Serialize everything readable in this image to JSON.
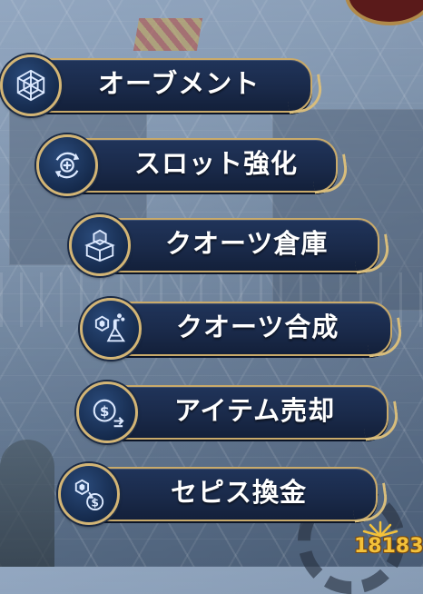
{
  "menu": {
    "items": [
      {
        "label": "オーブメント",
        "icon": "orbment-icon"
      },
      {
        "label": "スロット強化",
        "icon": "slot-upgrade-icon"
      },
      {
        "label": "クオーツ倉庫",
        "icon": "quartz-storage-icon"
      },
      {
        "label": "クオーツ合成",
        "icon": "quartz-synthesis-icon"
      },
      {
        "label": "アイテム売却",
        "icon": "item-sell-icon"
      },
      {
        "label": "セピス換金",
        "icon": "sepith-exchange-icon"
      }
    ]
  },
  "watermark": {
    "text": "18183"
  },
  "colors": {
    "bar": "#1a2a4a",
    "gold_trim": "#c9aa6a",
    "icon_glyph": "#dce9ff",
    "watermark": "#f3c13a"
  }
}
